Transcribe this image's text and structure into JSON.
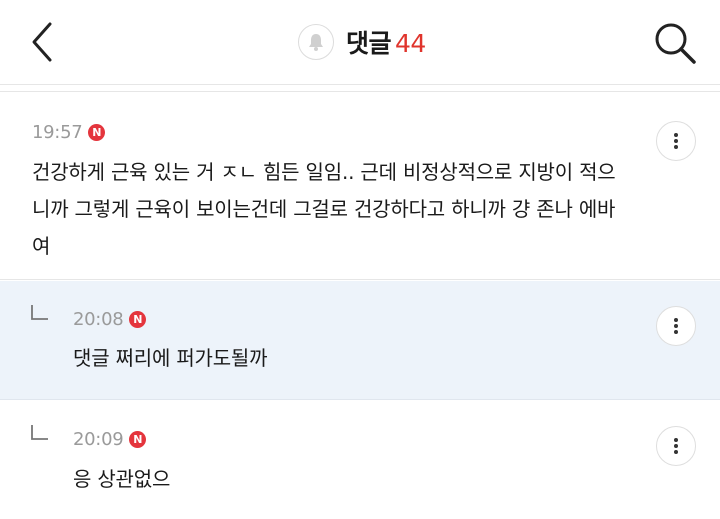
{
  "header": {
    "title": "댓글",
    "count": "44",
    "icons": {
      "back": "chevron-left-icon",
      "bell": "bell-icon",
      "search": "search-icon"
    }
  },
  "colors": {
    "accent": "#e0342c",
    "reply_bg": "#edf3fa",
    "badge": "#e4353d"
  },
  "comments": [
    {
      "time": "19:57",
      "badge": "N",
      "text": "건강하게 근육 있는 거 ㅈㄴ 힘든 일임.. 근데 비정상적으로 지방이 적으니까 그렇게 근육이 보이는건데 그걸로 건강하다고 하니까 걍 존나 에바여"
    },
    {
      "time": "20:08",
      "badge": "N",
      "text": "댓글 쩌리에 퍼가도될까",
      "reply": true
    },
    {
      "time": "20:09",
      "badge": "N",
      "text": "응 상관없으",
      "reply": true
    }
  ]
}
